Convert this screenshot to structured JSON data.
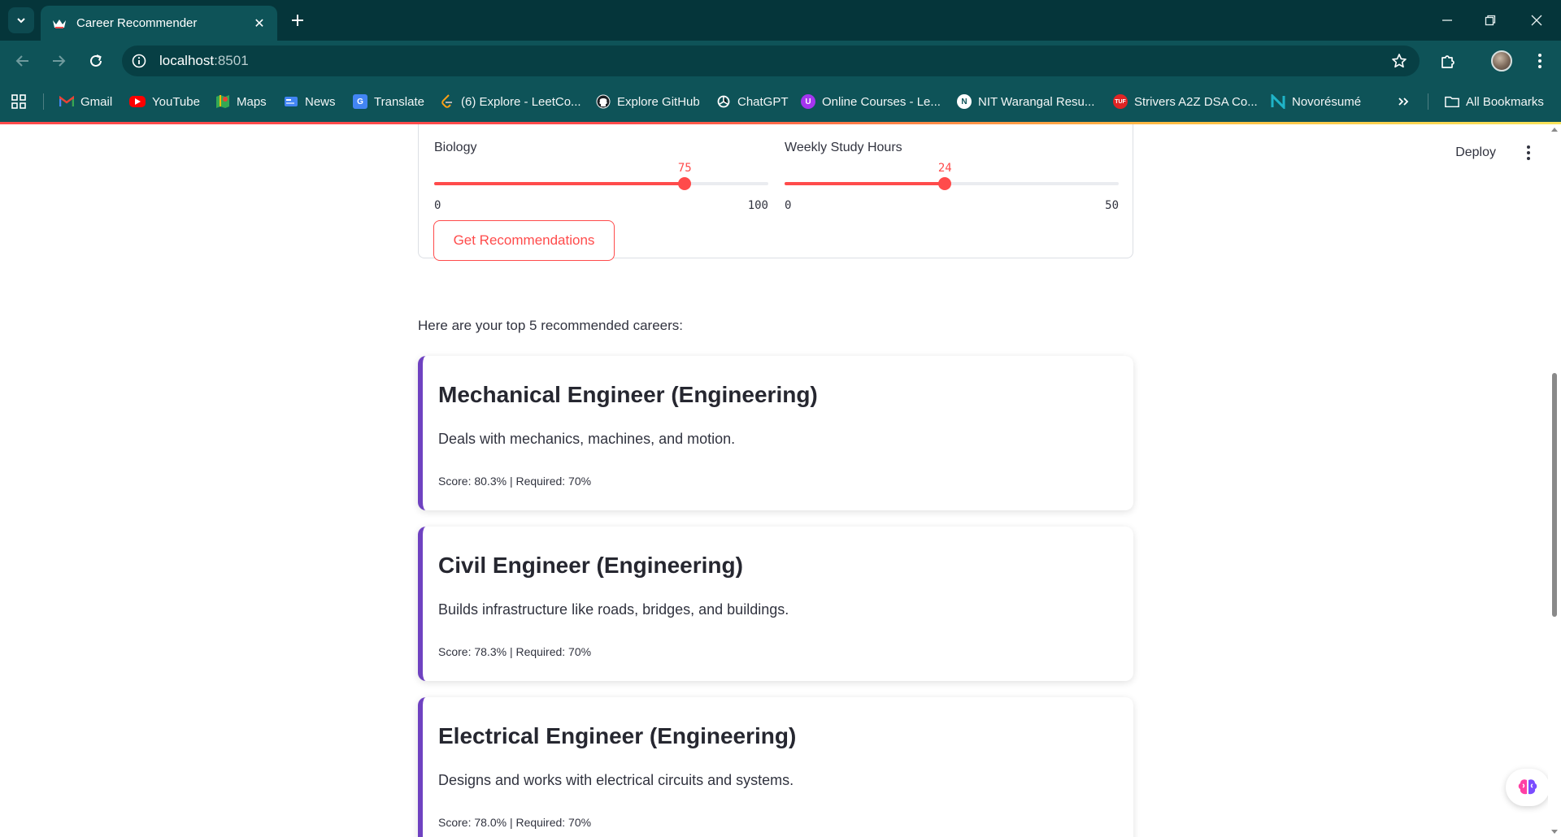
{
  "browser": {
    "tab_title": "Career Recommender",
    "url_host": "localhost",
    "url_port": ":8501"
  },
  "bookmarks": [
    {
      "label": "Gmail",
      "icon": "gmail-icon",
      "color": "#ea4335"
    },
    {
      "label": "YouTube",
      "icon": "youtube-icon",
      "color": "#ff0000"
    },
    {
      "label": "Maps",
      "icon": "maps-icon",
      "color": "#34a853"
    },
    {
      "label": "News",
      "icon": "news-icon",
      "color": "#4285f4"
    },
    {
      "label": "Translate",
      "icon": "translate-icon",
      "color": "#4285f4"
    },
    {
      "label": "(6) Explore - LeetCo...",
      "icon": "leetcode-icon",
      "color": "#ffa116"
    },
    {
      "label": "Explore GitHub",
      "icon": "github-icon",
      "color": "#ffffff"
    },
    {
      "label": "ChatGPT",
      "icon": "chatgpt-icon",
      "color": "#ffffff"
    },
    {
      "label": "Online Courses - Le...",
      "icon": "udemy-icon",
      "color": "#a435f0"
    },
    {
      "label": "NIT Warangal Resu...",
      "icon": "nitw-icon",
      "color": "#ffffff"
    },
    {
      "label": "Strivers A2Z DSA Co...",
      "icon": "tuf-icon",
      "color": "#e02424"
    },
    {
      "label": "Novorésumé",
      "icon": "novoresume-icon",
      "color": "#1fb4c8"
    }
  ],
  "all_bookmarks_label": "All Bookmarks",
  "app": {
    "deploy_label": "Deploy",
    "sliders": [
      {
        "label": "Biology",
        "value": 75,
        "min": 0,
        "max": 100
      },
      {
        "label": "Weekly Study Hours",
        "value": 24,
        "min": 0,
        "max": 50
      }
    ],
    "button_label": "Get Recommendations",
    "intro_text": "Here are your top 5 recommended careers:",
    "accent_color": "#ff4b4b",
    "card_border_color": "#6f42c1",
    "careers": [
      {
        "title": "Mechanical Engineer (Engineering)",
        "description": "Deals with mechanics, machines, and motion.",
        "score": "Score: 80.3% | Required: 70%"
      },
      {
        "title": "Civil Engineer (Engineering)",
        "description": "Builds infrastructure like roads, bridges, and buildings.",
        "score": "Score: 78.3% | Required: 70%"
      },
      {
        "title": "Electrical Engineer (Engineering)",
        "description": "Designs and works with electrical circuits and systems.",
        "score": "Score: 78.0% | Required: 70%"
      }
    ]
  }
}
